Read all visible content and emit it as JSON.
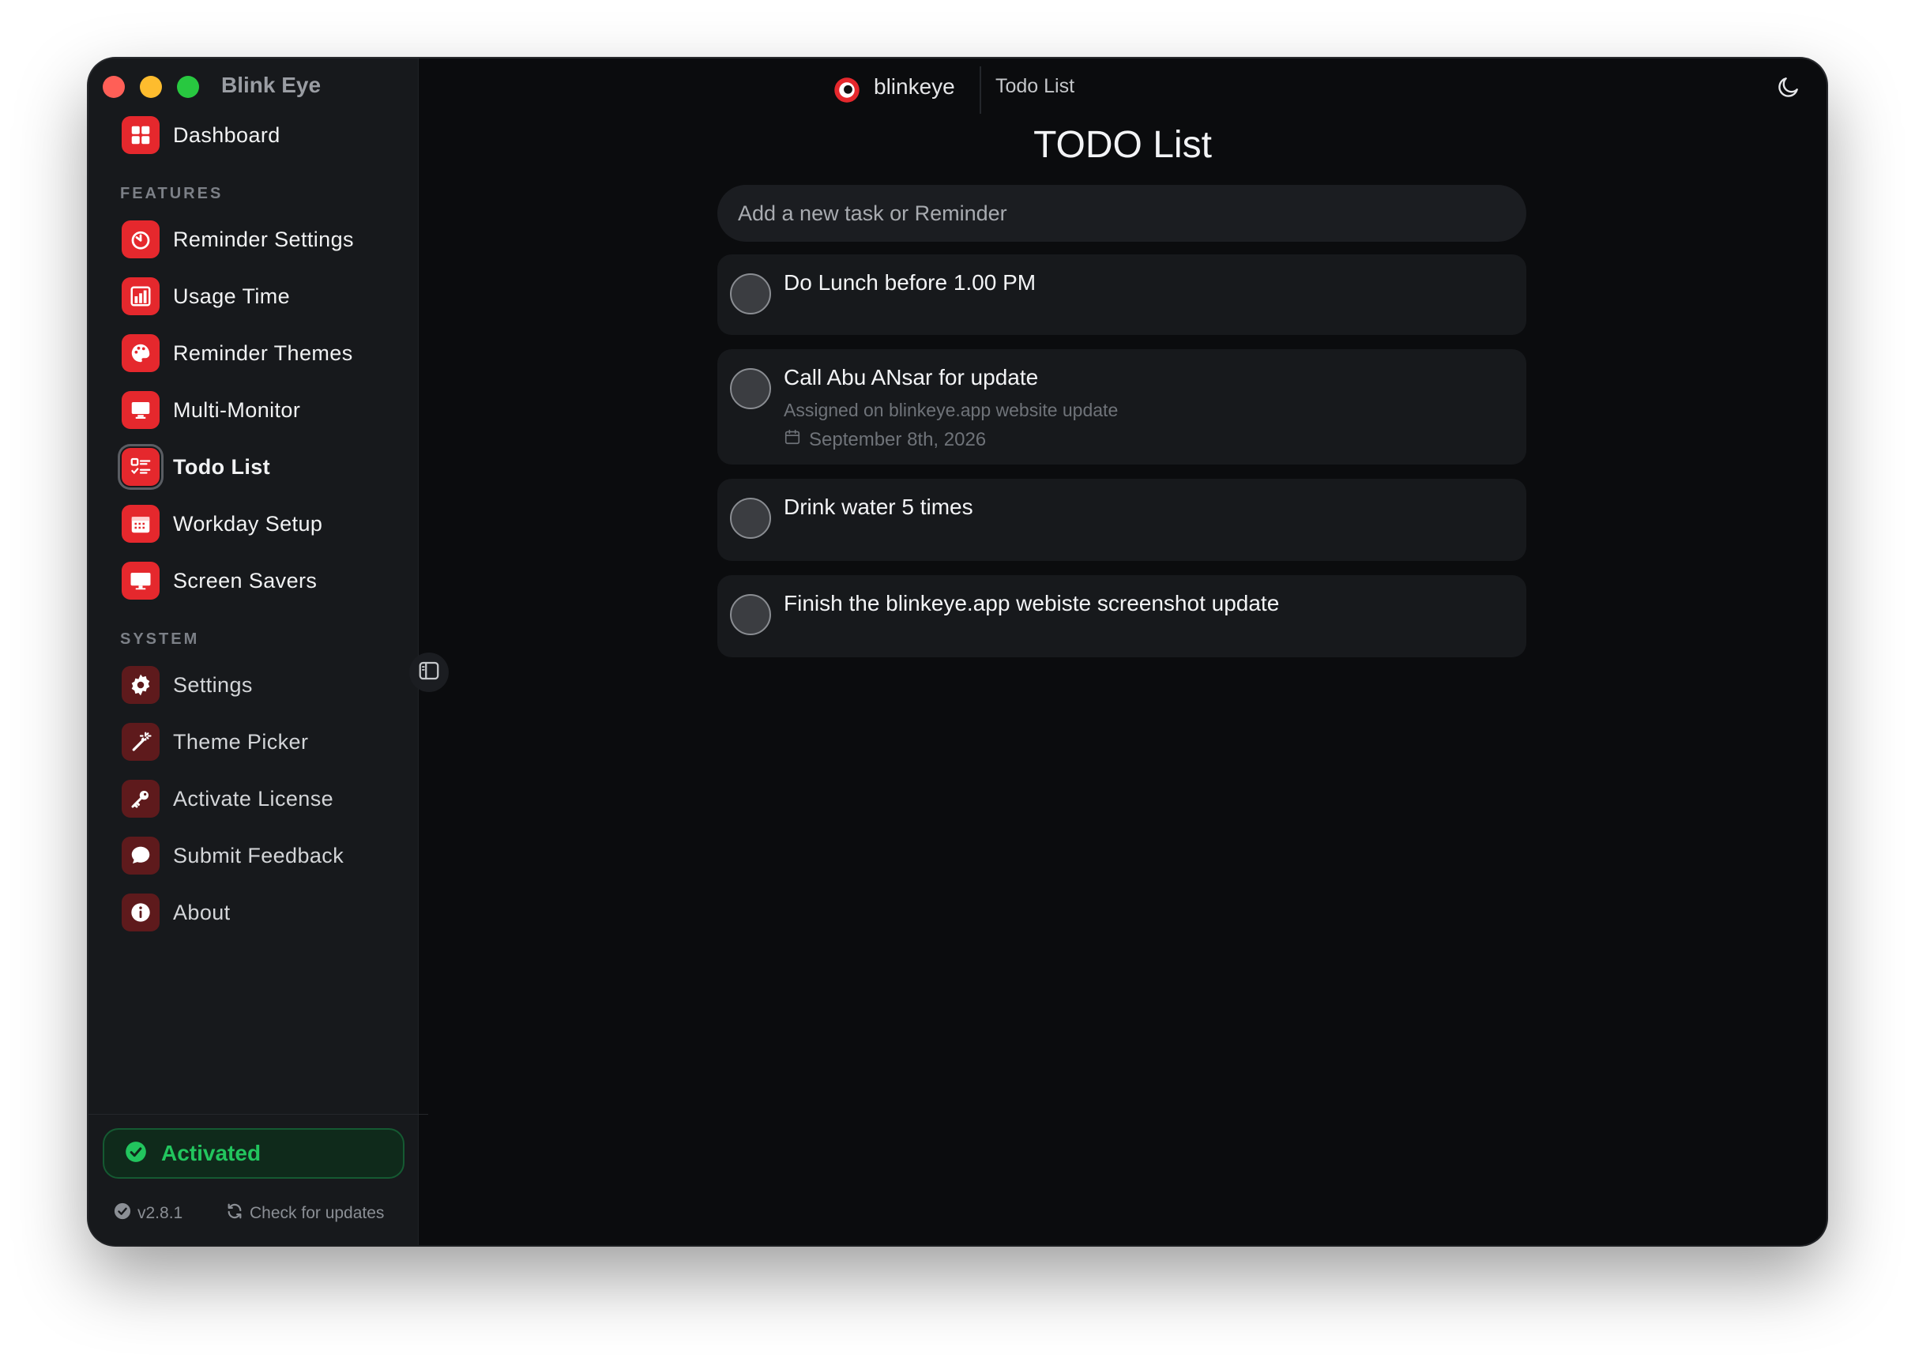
{
  "window": {
    "app_name": "Blink Eye"
  },
  "topbar": {
    "brand": "blinkeye",
    "page": "Todo List"
  },
  "sidebar": {
    "dashboard": {
      "label": "Dashboard",
      "icon": "dashboard-grid-icon"
    },
    "features_heading": "FEATURES",
    "features": [
      {
        "label": "Reminder Settings",
        "icon": "timer-icon"
      },
      {
        "label": "Usage Time",
        "icon": "bar-chart-icon"
      },
      {
        "label": "Reminder Themes",
        "icon": "palette-icon"
      },
      {
        "label": "Multi-Monitor",
        "icon": "monitor-icon"
      },
      {
        "label": "Todo List",
        "icon": "checklist-icon",
        "active": true
      },
      {
        "label": "Workday Setup",
        "icon": "calendar-icon"
      },
      {
        "label": "Screen Savers",
        "icon": "screen-icon"
      }
    ],
    "system_heading": "SYSTEM",
    "system": [
      {
        "label": "Settings",
        "icon": "gear-icon"
      },
      {
        "label": "Theme Picker",
        "icon": "magic-wand-icon"
      },
      {
        "label": "Activate License",
        "icon": "key-icon"
      },
      {
        "label": "Submit Feedback",
        "icon": "chat-bubble-icon"
      },
      {
        "label": "About",
        "icon": "info-icon"
      }
    ],
    "status": "Activated",
    "version": "v2.8.1",
    "check_updates": "Check for updates"
  },
  "main": {
    "title": "TODO List",
    "input_placeholder": "Add a new task or Reminder",
    "todos": [
      {
        "title": "Do Lunch before 1.00 PM"
      },
      {
        "title": "Call Abu ANsar for update",
        "description": "Assigned on blinkeye.app website update",
        "date": "September 8th, 2026"
      },
      {
        "title": "Drink water 5 times"
      },
      {
        "title": "Finish the blinkeye.app webiste screenshot update"
      }
    ]
  },
  "colors": {
    "accent": "#e5282d",
    "accent_dim": "#5e1a1c",
    "activated_green": "#22c55e",
    "window_bg": "#0b0c0e",
    "sidebar_bg": "#17191c",
    "card_bg": "#17191c"
  }
}
